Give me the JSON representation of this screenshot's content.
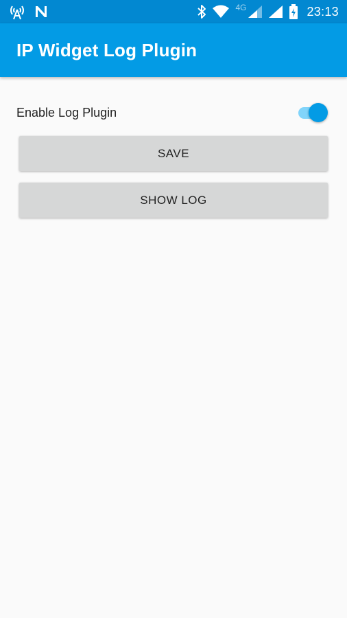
{
  "status_bar": {
    "time": "23:13",
    "network_type": "4G",
    "left_icons": [
      "wireless-antenna-icon",
      "n-notification-icon"
    ],
    "right_icons": [
      "bluetooth-icon",
      "wifi-icon",
      "signal-icon",
      "signal-icon",
      "battery-icon"
    ]
  },
  "app_bar": {
    "title": "IP Widget Log Plugin",
    "color": "#039be5"
  },
  "settings": {
    "enable_label": "Enable Log Plugin",
    "enabled": true
  },
  "buttons": {
    "save": "SAVE",
    "show_log": "SHOW LOG"
  },
  "colors": {
    "accent": "#039be5",
    "status_bar": "#0288d1",
    "button_bg": "#d6d7d7",
    "background": "#fafafa"
  }
}
